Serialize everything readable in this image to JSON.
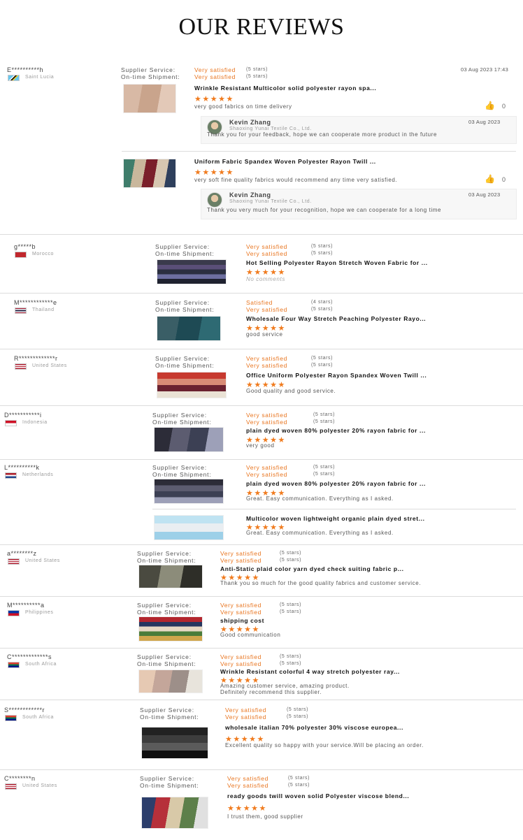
{
  "title": "OUR REVIEWS",
  "labels": {
    "supplier_service": "Supplier Service:",
    "ontime_shipment": "On-time Shipment:"
  },
  "reviews": [
    {
      "buyer": "E**********h",
      "country": "Saint Lucia",
      "date": "03 Aug 2023 17:43",
      "supplier_rating": "Very satisfied",
      "supplier_stars": "(5 stars)",
      "ontime_rating": "Very satisfied",
      "ontime_stars": "(5 stars)",
      "products": [
        {
          "title": "Wrinkle Resistant Multicolor solid polyester rayon spa...",
          "stars": "★★★★★",
          "comment": "very good fabrics on time delivery",
          "likes": "0",
          "reply": {
            "name": "Kevin Zhang",
            "company": "Shaoxing Yunai Textile Co., Ltd.",
            "date": "03 Aug 2023",
            "text": "Thank you for your feedback, hope we can cooperate more product in the future"
          }
        },
        {
          "title": "Uniform Fabric Spandex Woven Polyester Rayon Twill ...",
          "stars": "★★★★★",
          "comment": "very soft fine quality fabrics would recommend any time very satisfied.",
          "likes": "0",
          "reply": {
            "name": "Kevin Zhang",
            "company": "Shaoxing Yunai Textile Co., Ltd.",
            "date": "03 Aug 2023",
            "text": "Thank you very much for your recognition,  hope we can cooperate for a long time"
          }
        }
      ]
    },
    {
      "buyer": "g*****b",
      "country": "Morocco",
      "supplier_rating": "Very satisfied",
      "supplier_stars": "(5 stars)",
      "ontime_rating": "Very satisfied",
      "ontime_stars": "(5 stars)",
      "products": [
        {
          "title": "Hot Selling Polyester Rayon Stretch Woven Fabric for ...",
          "stars": "★★★★★",
          "comment": "No comments"
        }
      ]
    },
    {
      "buyer": "M************e",
      "country": "Thailand",
      "supplier_rating": "Satisfied",
      "supplier_stars": "(4 stars)",
      "ontime_rating": "Very satisfied",
      "ontime_stars": "(5 stars)",
      "products": [
        {
          "title": "Wholesale Four Way Stretch Peaching Polyester Rayo...",
          "stars": "★★★★★",
          "comment": "good service"
        }
      ]
    },
    {
      "buyer": "R*************r",
      "country": "United States",
      "supplier_rating": "Very satisfied",
      "supplier_stars": "(5 stars)",
      "ontime_rating": "Very satisfied",
      "ontime_stars": "(5 stars)",
      "products": [
        {
          "title": "Office Uniform Polyester Rayon Spandex Woven Twill ...",
          "stars": "★★★★★",
          "comment": "Good quality and good service."
        }
      ]
    },
    {
      "buyer": "D***********i",
      "country": "Indonesia",
      "supplier_rating": "Very satisfied",
      "supplier_stars": "(5 stars)",
      "ontime_rating": "Very satisfied",
      "ontime_stars": "(5 stars)",
      "products": [
        {
          "title": "plain dyed woven 80% polyester 20% rayon fabric for ...",
          "stars": "★★★★★",
          "comment": "very good"
        }
      ]
    },
    {
      "buyer": "L**********k",
      "country": "Netherlands",
      "supplier_rating": "Very satisfied",
      "supplier_stars": "(5 stars)",
      "ontime_rating": "Very satisfied",
      "ontime_stars": "(5 stars)",
      "products": [
        {
          "title": "plain dyed woven 80% polyester 20% rayon fabric for ...",
          "stars": "★★★★★",
          "comment": "Great. Easy communication. Everything as I asked."
        },
        {
          "title": "Multicolor woven lightweight organic plain dyed stret...",
          "stars": "★★★★★",
          "comment": "Great. Easy communication. Everything as I asked."
        }
      ]
    },
    {
      "buyer": "a********z",
      "country": "United States",
      "supplier_rating": "Very satisfied",
      "supplier_stars": "(5 stars)",
      "ontime_rating": "Very satisfied",
      "ontime_stars": "(5 stars)",
      "products": [
        {
          "title": "Anti-Static plaid color yarn dyed check suiting fabric p...",
          "stars": "★★★★★",
          "comment": "Thank you so much for the good quality fabrics and customer service."
        }
      ]
    },
    {
      "buyer": "M**********a",
      "country": "Philippines",
      "supplier_rating": "Very satisfied",
      "supplier_stars": "(5 stars)",
      "ontime_rating": "Very satisfied",
      "ontime_stars": "(5 stars)",
      "products": [
        {
          "title": "shipping cost",
          "stars": "★★★★★",
          "comment": "Good communication"
        }
      ]
    },
    {
      "buyer": "C*************s",
      "country": "South Africa",
      "supplier_rating": "Very satisfied",
      "supplier_stars": "(5 stars)",
      "ontime_rating": "Very satisfied",
      "ontime_stars": "(5 stars)",
      "products": [
        {
          "title": "Wrinkle Resistant colorful 4 way stretch polyester ray...",
          "stars": "★★★★★",
          "comment": "Amazing customer service, amazing product.",
          "comment2": "Definitely recommend this supplier."
        }
      ]
    },
    {
      "buyer": "S************r",
      "country": "South Africa",
      "supplier_rating": "Very satisfied",
      "supplier_stars": "(5 stars)",
      "ontime_rating": "Very satisfied",
      "ontime_stars": "(5 stars)",
      "products": [
        {
          "title": "wholesale italian 70% polyester 30% viscose europea...",
          "stars": "★★★★★",
          "comment": "Excellent quality so happy with your service.Will be placing an order."
        }
      ]
    },
    {
      "buyer": "C********n",
      "country": "United States",
      "supplier_rating": "Very satisfied",
      "supplier_stars": "(5 stars)",
      "ontime_rating": "Very satisfied",
      "ontime_stars": "(5 stars)",
      "products": [
        {
          "title": "ready goods twill woven solid Polyester viscose blend...",
          "stars": "★★★★★",
          "comment": "I trust them, good supplier"
        }
      ]
    }
  ]
}
